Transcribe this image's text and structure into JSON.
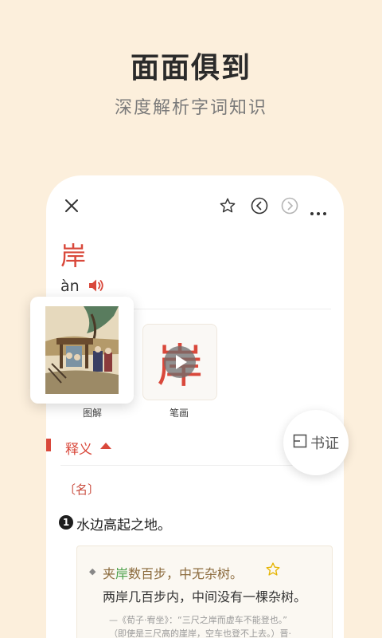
{
  "promo": {
    "headline": "面面俱到",
    "subline": "深度解析字词知识"
  },
  "toolbar": {
    "close_icon": "close-icon",
    "favorite_icon": "star-outline-icon",
    "prev_icon": "chevron-left-circle-icon",
    "next_icon": "chevron-right-circle-icon",
    "more_icon": "more-dots-icon"
  },
  "entry": {
    "character": "岸",
    "pinyin": "àn",
    "audio_icon": "speaker-icon"
  },
  "media": {
    "illustration_label": "图解",
    "stroke_label": "笔画",
    "stroke_character": "岸"
  },
  "definition_section": {
    "title": "释义",
    "citation_label": "书证",
    "part_of_speech": "〔名〕",
    "sense_number": "1",
    "sense_text": "水边高起之地。",
    "example": {
      "before": "夹",
      "highlight": "岸",
      "after": "数百步，中无杂树。",
      "translation": "两岸几百步内，中间没有一棵杂树。",
      "source_line1": "—《荀子·宥坐》：“三尺之岸而虚车不能登也。”",
      "source_line2": "（即使是三尺高的崖岸，空车也登不上去。）晋·"
    }
  },
  "colors": {
    "background": "#fcefdc",
    "accent_red": "#d9483b",
    "highlight_green": "#4fa24d",
    "example_brown": "#8b6a3c"
  }
}
